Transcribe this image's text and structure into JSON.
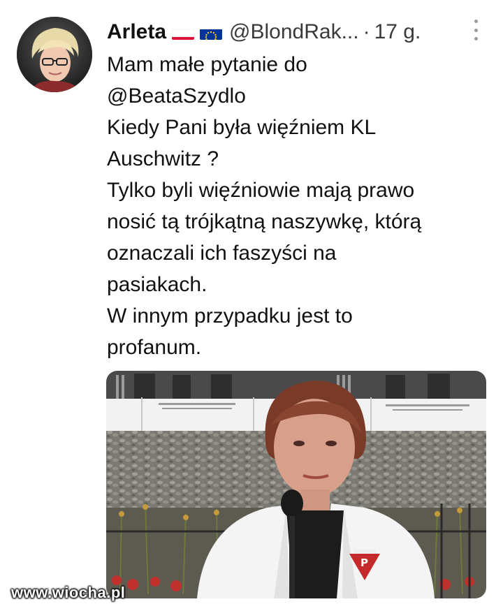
{
  "tweet": {
    "author": "Arleta",
    "handle": "@BlondRak...",
    "separator": "·",
    "time": "17 g.",
    "text_lines": [
      "Mam małe pytanie do",
      "@BeataSzydlo",
      "Kiedy Pani była więźniem KL",
      "Auschwitz ?",
      "Tylko byli więźniowie mają prawo",
      "nosić tą trójkątną naszywkę, którą",
      "oznaczali ich faszyści na",
      "pasiakach.",
      "W innym przypadku jest to",
      "profanum."
    ],
    "photo": {
      "badge_letter": "P"
    }
  },
  "icons": {
    "flags": [
      "flag-poland-icon",
      "flag-eu-icon"
    ],
    "menu": "more-options-icon"
  },
  "colors": {
    "poland_white": "#ffffff",
    "poland_red": "#dc143c",
    "eu_blue": "#003399",
    "eu_star": "#ffcc00"
  },
  "watermark": "www.wiocha.pl"
}
